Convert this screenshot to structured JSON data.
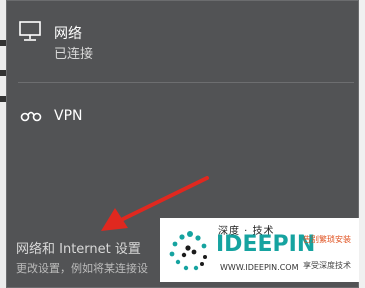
{
  "networks": [
    {
      "name": "网络",
      "status": "已连接",
      "icon": "ethernet-monitor-icon"
    },
    {
      "name": "VPN",
      "icon": "vpn-link-icon"
    }
  ],
  "settings": {
    "link_label": "网络和 Internet 设置",
    "description": "更改设置，例如将某连接设"
  },
  "watermark": {
    "top_text": "深度 · 技术",
    "brand": "IDEEPIN",
    "url": "WWW.IDEEPIN.COM",
    "side_top": "告别繁琐安装",
    "side_bottom": "享受深度技术"
  },
  "colors": {
    "flyout_bg": "#525355",
    "arrow": "#e0281f",
    "brand": "#16a3a0"
  }
}
